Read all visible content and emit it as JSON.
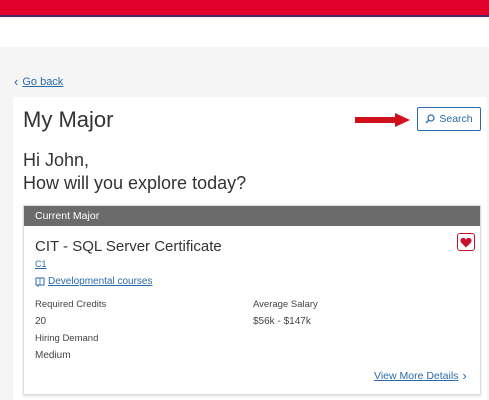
{
  "nav": {
    "back_label": "Go back"
  },
  "page": {
    "title": "My Major",
    "search_label": "Search",
    "greeting_line1": "Hi John,",
    "greeting_line2": "How will you explore today?"
  },
  "current_major": {
    "header": "Current Major",
    "name": "CIT - SQL Server Certificate",
    "code": "C1",
    "dev_courses_label": "Developmental courses",
    "required_credits_label": "Required Credits",
    "required_credits_value": "20",
    "average_salary_label": "Average Salary",
    "average_salary_value": "$56k - $147k",
    "hiring_demand_label": "Hiring Demand",
    "hiring_demand_value": "Medium",
    "view_more_label": "View More Details",
    "favorited": true
  },
  "colors": {
    "brand_red": "#e0002a",
    "link_blue": "#2a6aa8",
    "header_gray": "#6b6b6b",
    "arrow_red": "#d0101a"
  }
}
